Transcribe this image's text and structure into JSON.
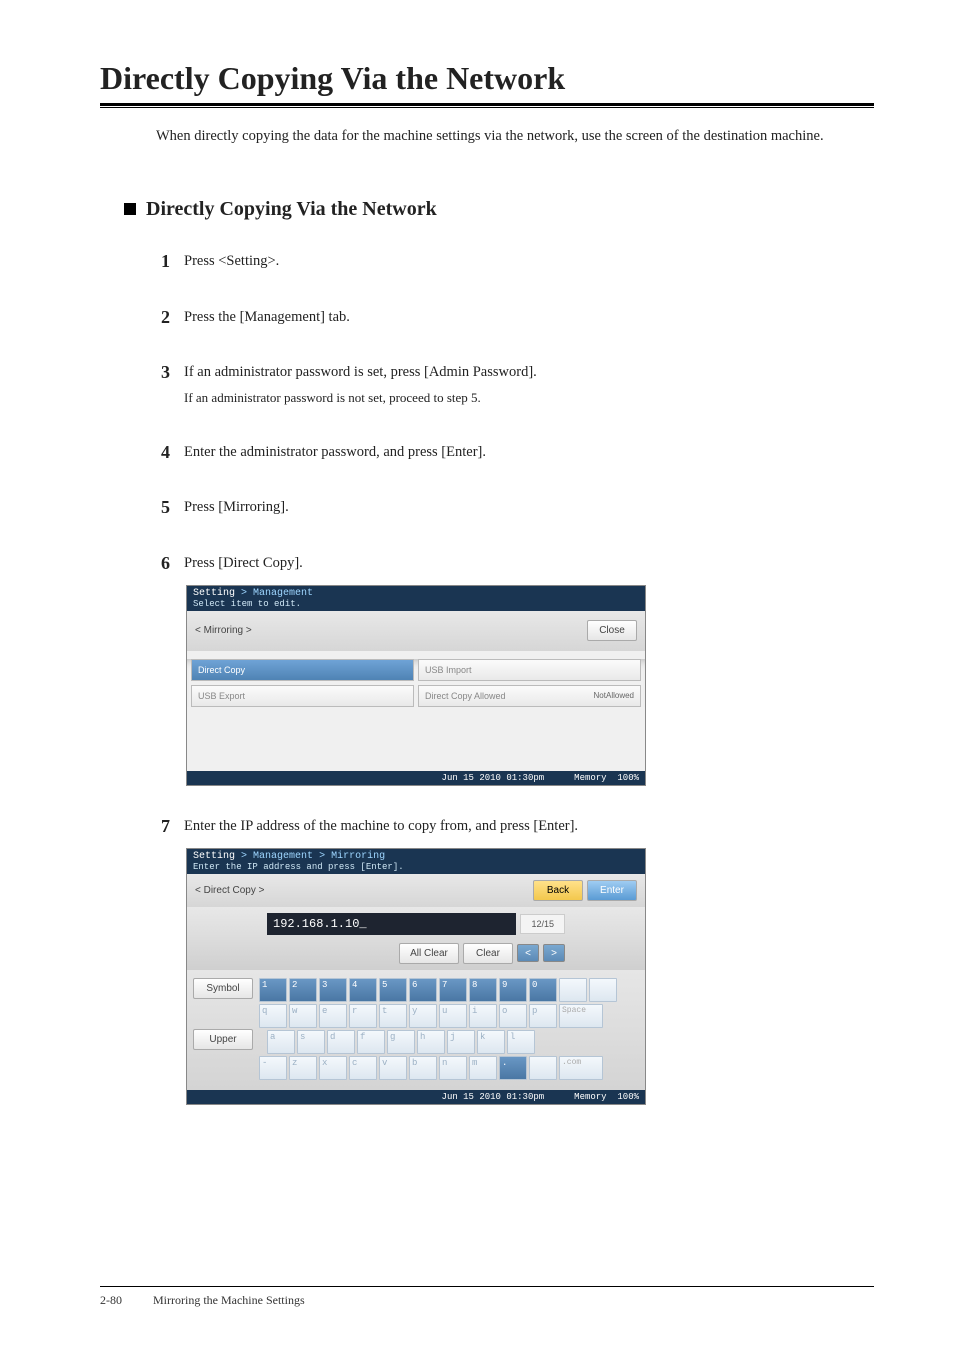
{
  "title": "Directly Copying Via the Network",
  "intro": "When directly copying the data for the machine settings via the network, use the screen of the destination machine.",
  "subheading": "Directly Copying Via the Network",
  "steps": {
    "s1": "Press <Setting>.",
    "s2": "Press the [Management] tab.",
    "s3": "If an administrator password is set, press [Admin Password].",
    "s3sub": "If an administrator password is not set, proceed to step 5.",
    "s4": "Enter the administrator password, and press [Enter].",
    "s5": "Press [Mirroring].",
    "s6": "Press [Direct Copy].",
    "s7": "Enter the IP address of the machine to copy from, and press [Enter]."
  },
  "ss1": {
    "bc_a": "Setting",
    "bc_b": "Management",
    "sub": "Select item to edit.",
    "toolbar_title": "< Mirroring >",
    "close": "Close",
    "cells": {
      "direct_copy": "Direct Copy",
      "usb_import": "USB Import",
      "usb_export": "USB Export",
      "dca": "Direct Copy Allowed",
      "dca_val": "NotAllowed"
    },
    "datetime": "Jun 15 2010 01:30pm",
    "mem_label": "Memory",
    "mem_val": "100%"
  },
  "ss2": {
    "bc_a": "Setting",
    "bc_b": "Management",
    "bc_c": "Mirroring",
    "sub": "Enter the IP address and press [Enter].",
    "toolbar_title": "< Direct Copy >",
    "back": "Back",
    "enter": "Enter",
    "ip": "192.168.1.10_",
    "counter": "12/15",
    "all_clear": "All Clear",
    "clear": "Clear",
    "symbol": "Symbol",
    "upper": "Upper",
    "space": "Space",
    "com": ".com",
    "datetime": "Jun 15 2010 01:30pm",
    "mem_label": "Memory",
    "mem_val": "100%",
    "keys_r1": [
      "1",
      "2",
      "3",
      "4",
      "5",
      "6",
      "7",
      "8",
      "9",
      "0"
    ],
    "keys_r2": [
      "q",
      "w",
      "e",
      "r",
      "t",
      "y",
      "u",
      "i",
      "o",
      "p"
    ],
    "keys_r3": [
      "a",
      "s",
      "d",
      "f",
      "g",
      "h",
      "j",
      "k",
      "l"
    ],
    "keys_r4": [
      "-",
      "z",
      "x",
      "c",
      "v",
      "b",
      "n",
      "m",
      "."
    ]
  },
  "footer": {
    "page": "2-80",
    "section": "Mirroring the Machine Settings"
  }
}
